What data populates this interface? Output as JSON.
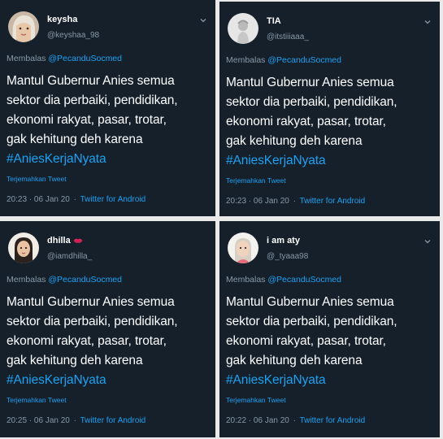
{
  "tweets": [
    {
      "name": "keysha",
      "handle": "@keyshaa_98",
      "reply_prefix": "Membalas",
      "reply_to": "@PecanduSocmed",
      "lines": [
        "Mantul Gubernur Anies semua",
        "sektor dia perbaiki, pendidikan,",
        "ekonomi rakyat, pasar, trotar,",
        "gak kehitung deh karena"
      ],
      "hashtag": "#AniesKerjaNyata",
      "translate": "Terjemahkan Tweet",
      "time": "20:23 · 06 Jan 20",
      "sep": "·",
      "source": "Twitter for Android"
    },
    {
      "name": "TIA",
      "handle": "@itstiiiaaa_",
      "reply_prefix": "Membalas",
      "reply_to": "@PecanduSocmed",
      "lines": [
        "Mantul Gubernur Anies semua",
        "sektor dia perbaiki, pendidikan,",
        "ekonomi rakyat, pasar, trotar,",
        "gak kehitung deh karena"
      ],
      "hashtag": "#AniesKerjaNyata",
      "translate": "Terjemahkan Tweet",
      "time": "20:23 · 06 Jan 20",
      "sep": "·",
      "source": "Twitter for Android"
    },
    {
      "name": "dhilla",
      "handle": "@iamdhilla_",
      "reply_prefix": "Membalas",
      "reply_to": "@PecanduSocmed",
      "lines": [
        "Mantul Gubernur Anies semua",
        "sektor dia perbaiki, pendidikan,",
        "ekonomi rakyat, pasar, trotar,",
        "gak kehitung deh karena"
      ],
      "hashtag": "#AniesKerjaNyata",
      "translate": "Terjemahkan Tweet",
      "time": "20:25 · 06 Jan 20",
      "sep": "·",
      "source": "Twitter for Android"
    },
    {
      "name": "i am aty",
      "handle": "@_tyaaa98",
      "reply_prefix": "Membalas",
      "reply_to": "@PecanduSocmed",
      "lines": [
        "Mantul Gubernur Anies semua",
        "sektor dia perbaiki, pendidikan,",
        "ekonomi rakyat, pasar, trotar,",
        "gak kehitung deh karena"
      ],
      "hashtag": "#AniesKerjaNyata",
      "translate": "Terjemahkan Tweet",
      "time": "20:22 · 06 Jan 20",
      "sep": "·",
      "source": "Twitter for Android"
    }
  ],
  "colors": {
    "card_bg": "#15202b",
    "text": "#ffffff",
    "muted": "#8899a6",
    "link": "#1da1f2",
    "page_bg": "#e9e9e9"
  }
}
